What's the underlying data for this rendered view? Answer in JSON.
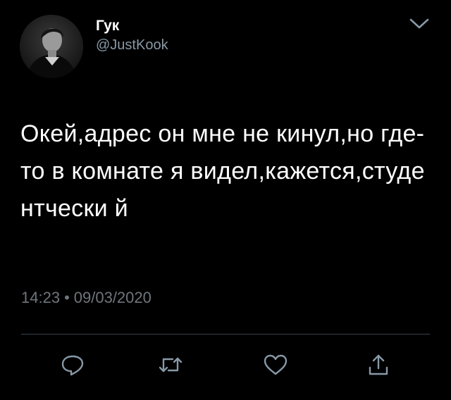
{
  "author": {
    "display_name": "Гук",
    "handle": "@JustKook"
  },
  "tweet": {
    "text": "Окей,адрес он мне не кинул,но где-то в комнате я видел,кажется,студентчески й",
    "time": "14:23",
    "separator": "•",
    "date": "09/03/2020"
  },
  "icons": {
    "more": "chevron-down-icon",
    "reply": "reply-icon",
    "retweet": "retweet-icon",
    "like": "heart-icon",
    "share": "share-icon"
  },
  "colors": {
    "background": "#000000",
    "text": "#ffffff",
    "secondary_text": "#8899a6",
    "icon": "#8899a6",
    "divider": "#38444d"
  }
}
